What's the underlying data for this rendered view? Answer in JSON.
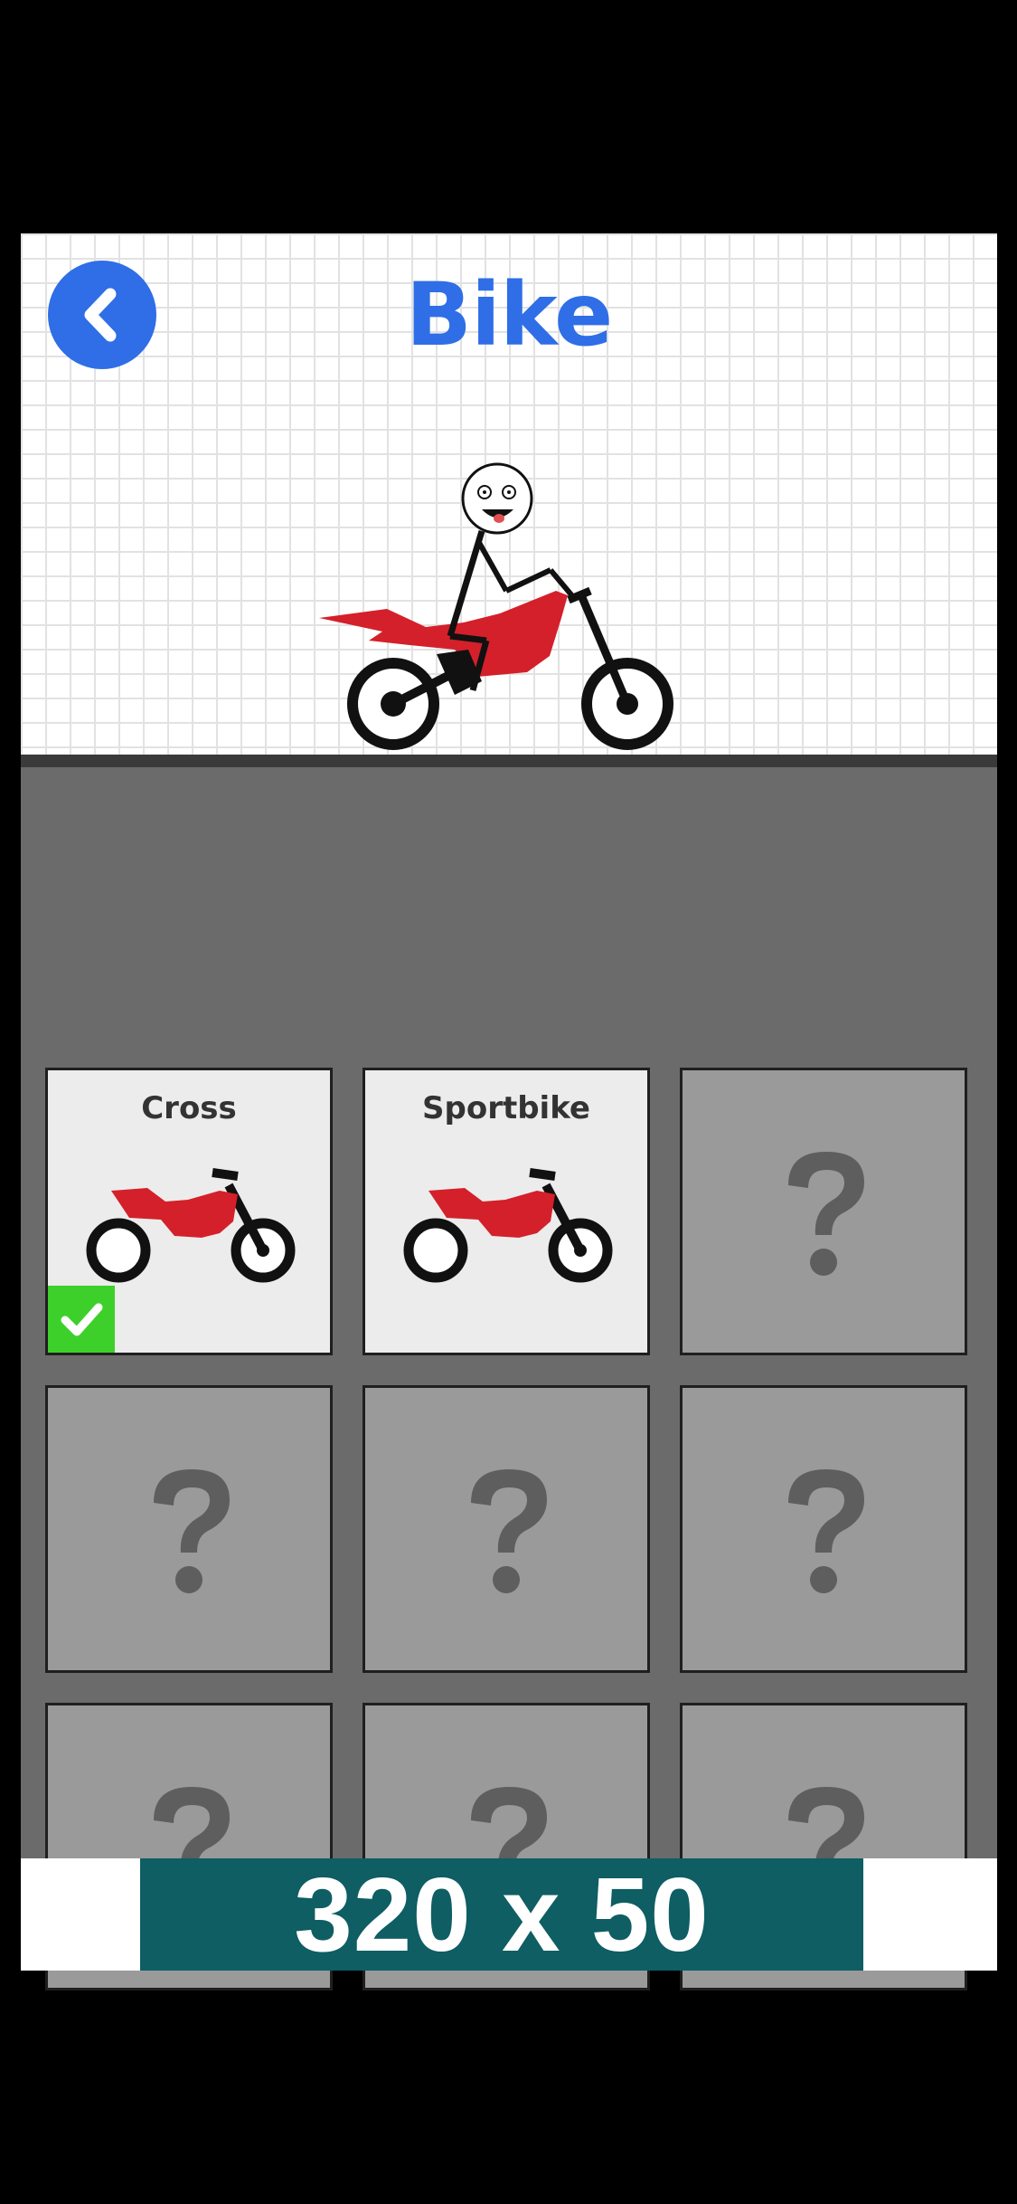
{
  "header": {
    "title": "Bike",
    "back_icon": "chevron-left-icon",
    "accent_color": "#2f6ee6"
  },
  "bikes": [
    {
      "name": "Cross",
      "locked": false,
      "selected": true
    },
    {
      "name": "Sportbike",
      "locked": false,
      "selected": false
    },
    {
      "name": "",
      "locked": true,
      "selected": false
    },
    {
      "name": "",
      "locked": true,
      "selected": false
    },
    {
      "name": "",
      "locked": true,
      "selected": false
    },
    {
      "name": "",
      "locked": true,
      "selected": false
    },
    {
      "name": "",
      "locked": true,
      "selected": false
    },
    {
      "name": "",
      "locked": true,
      "selected": false
    },
    {
      "name": "",
      "locked": true,
      "selected": false
    }
  ],
  "locked_icon": "question-mark-icon",
  "selected_icon": "checkmark-icon",
  "bike_color": "#d4202a",
  "ad": {
    "label": "320 x 50",
    "background": "#0e5e63"
  }
}
